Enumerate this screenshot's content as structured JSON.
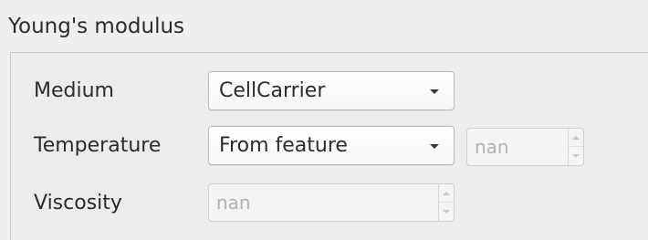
{
  "group": {
    "title": "Young's modulus"
  },
  "rows": {
    "medium": {
      "label": "Medium",
      "value": "CellCarrier"
    },
    "temperature": {
      "label": "Temperature",
      "value": "From feature",
      "spin_value": "nan"
    },
    "viscosity": {
      "label": "Viscosity",
      "spin_value": "nan"
    }
  },
  "icons": {
    "combo_arrow": "chevron-down-icon",
    "spin_up": "spin-up-icon",
    "spin_down": "spin-down-icon"
  }
}
